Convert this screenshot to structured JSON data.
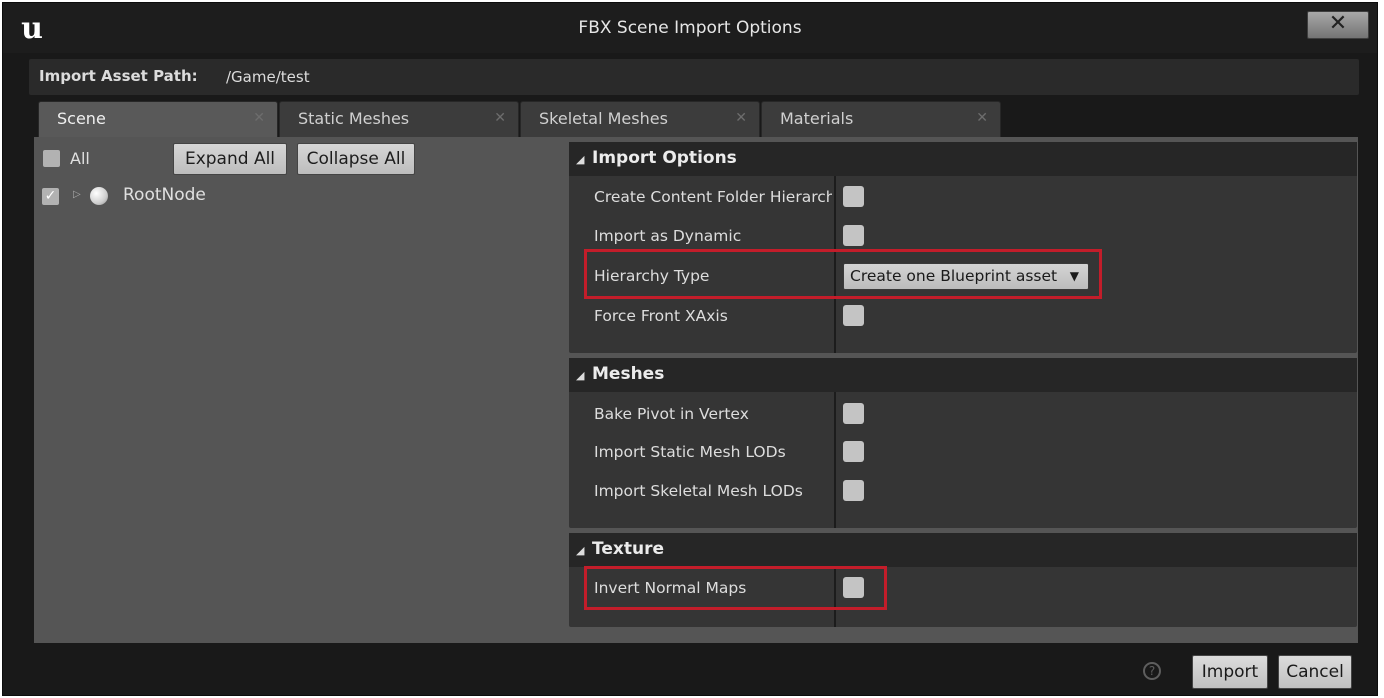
{
  "window": {
    "title": "FBX Scene Import Options",
    "logo_text": "u",
    "close_glyph": "✕"
  },
  "path": {
    "label": "Import Asset Path:",
    "value": "/Game/test"
  },
  "tabs": [
    {
      "label": "Scene",
      "active": true
    },
    {
      "label": "Static Meshes",
      "active": false
    },
    {
      "label": "Skeletal Meshes",
      "active": false
    },
    {
      "label": "Materials",
      "active": false
    }
  ],
  "tab_close_glyph": "✕",
  "scene_tree": {
    "all_label": "All",
    "all_checked": false,
    "expand_all": "Expand All",
    "collapse_all": "Collapse All",
    "nodes": [
      {
        "label": "RootNode",
        "checked": true,
        "expand_glyph": "▷",
        "check_glyph": "✓"
      }
    ]
  },
  "sections": [
    {
      "title": "Import Options",
      "tri_glyph": "◢",
      "properties": [
        {
          "label": "Create Content Folder Hierarchy",
          "type": "checkbox",
          "checked": false
        },
        {
          "label": "Import as Dynamic",
          "type": "checkbox",
          "checked": false
        },
        {
          "label": "Hierarchy Type",
          "type": "dropdown",
          "value": "Create one Blueprint asset",
          "highlighted": true
        },
        {
          "label": "Force Front XAxis",
          "type": "checkbox",
          "checked": false
        }
      ]
    },
    {
      "title": "Meshes",
      "tri_glyph": "◢",
      "properties": [
        {
          "label": "Bake Pivot in Vertex",
          "type": "checkbox",
          "checked": false
        },
        {
          "label": "Import Static Mesh LODs",
          "type": "checkbox",
          "checked": false
        },
        {
          "label": "Import Skeletal Mesh LODs",
          "type": "checkbox",
          "checked": false
        }
      ]
    },
    {
      "title": "Texture",
      "tri_glyph": "◢",
      "properties": [
        {
          "label": "Invert Normal Maps",
          "type": "checkbox",
          "checked": false,
          "highlighted": true
        }
      ]
    }
  ],
  "dropdown_arrow_glyph": "▼",
  "footer": {
    "help_glyph": "?",
    "import_label": "Import",
    "cancel_label": "Cancel"
  },
  "colors": {
    "window_bg": "#191919",
    "panel_bg": "#555555",
    "section_bg": "#353535",
    "highlight": "#c31d2a"
  }
}
